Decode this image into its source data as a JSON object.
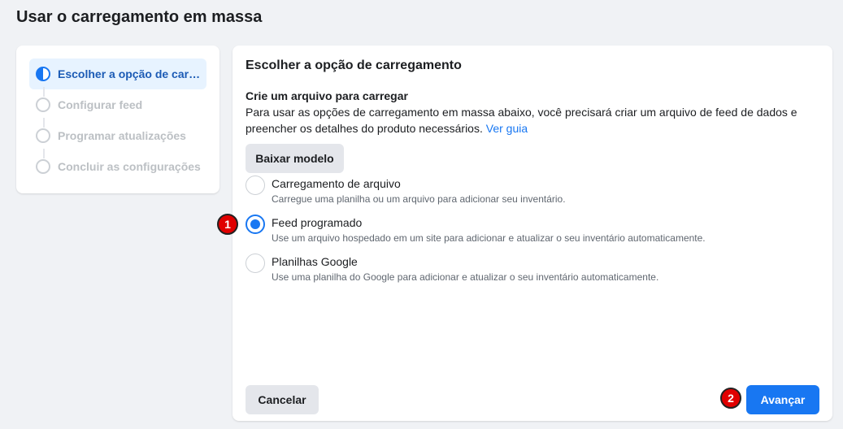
{
  "page": {
    "title": "Usar o carregamento em massa"
  },
  "steps": [
    {
      "label": "Escolher a opção de carre…",
      "state": "active"
    },
    {
      "label": "Configurar feed",
      "state": "pending"
    },
    {
      "label": "Programar atualizações",
      "state": "pending"
    },
    {
      "label": "Concluir as configurações",
      "state": "pending"
    }
  ],
  "panel": {
    "title": "Escolher a opção de carregamento",
    "section_heading": "Crie um arquivo para carregar",
    "description": "Para usar as opções de carregamento em massa abaixo, você precisará criar um arquivo de feed de dados e preencher os detalhes do produto necessários.",
    "guide_link": "Ver guia",
    "download_button": "Baixar modelo",
    "options": [
      {
        "label": "Carregamento de arquivo",
        "description": "Carregue uma planilha ou um arquivo para adicionar seu inventário.",
        "selected": false
      },
      {
        "label": "Feed programado",
        "description": "Use um arquivo hospedado em um site para adicionar e atualizar o seu inventário automaticamente.",
        "selected": true
      },
      {
        "label": "Planilhas Google",
        "description": "Use uma planilha do Google para adicionar e atualizar o seu inventário automaticamente.",
        "selected": false
      }
    ],
    "cancel_button": "Cancelar",
    "next_button": "Avançar"
  },
  "markers": [
    "1",
    "2"
  ],
  "colors": {
    "accent": "#1877f2",
    "marker": "#e00000",
    "background": "#f0f2f5"
  }
}
